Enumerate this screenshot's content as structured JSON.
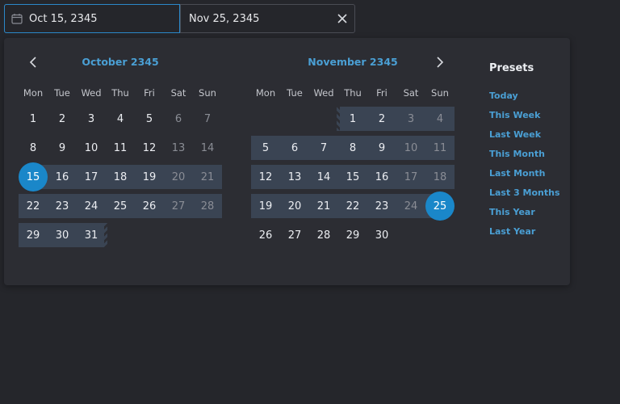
{
  "range": {
    "start": "Oct 15, 2345",
    "end": "Nov 25, 2345"
  },
  "colors": {
    "accent": "#1a87c9",
    "link": "#4a9fd4",
    "range_fill": "#3a4453",
    "panel": "#2c2d33",
    "background": "#25262b"
  },
  "calendar": {
    "weekdays": [
      "Mon",
      "Tue",
      "Wed",
      "Thu",
      "Fri",
      "Sat",
      "Sun"
    ],
    "months": [
      {
        "title": "October 2345",
        "weeks": [
          [
            "1",
            "2",
            "3",
            "4",
            "5",
            "6",
            "7"
          ],
          [
            "8",
            "9",
            "10",
            "11",
            "12",
            "13",
            "14"
          ],
          [
            "15",
            "16",
            "17",
            "18",
            "19",
            "20",
            "21"
          ],
          [
            "22",
            "23",
            "24",
            "25",
            "26",
            "27",
            "28"
          ],
          [
            "29",
            "30",
            "31",
            "",
            "",
            "",
            ""
          ]
        ]
      },
      {
        "title": "November 2345",
        "weeks": [
          [
            "",
            "",
            "",
            "1",
            "2",
            "3",
            "4"
          ],
          [
            "5",
            "6",
            "7",
            "8",
            "9",
            "10",
            "11"
          ],
          [
            "12",
            "13",
            "14",
            "15",
            "16",
            "17",
            "18"
          ],
          [
            "19",
            "20",
            "21",
            "22",
            "23",
            "24",
            "25"
          ],
          [
            "26",
            "27",
            "28",
            "29",
            "30",
            "",
            ""
          ]
        ]
      }
    ]
  },
  "presets": {
    "title": "Presets",
    "items": [
      "Today",
      "This Week",
      "Last Week",
      "This Month",
      "Last Month",
      "Last 3 Months",
      "This Year",
      "Last Year"
    ]
  },
  "icons": {
    "calendar": "calendar-icon",
    "clear": "close-icon",
    "prev": "chevron-left-icon",
    "next": "chevron-right-icon"
  }
}
